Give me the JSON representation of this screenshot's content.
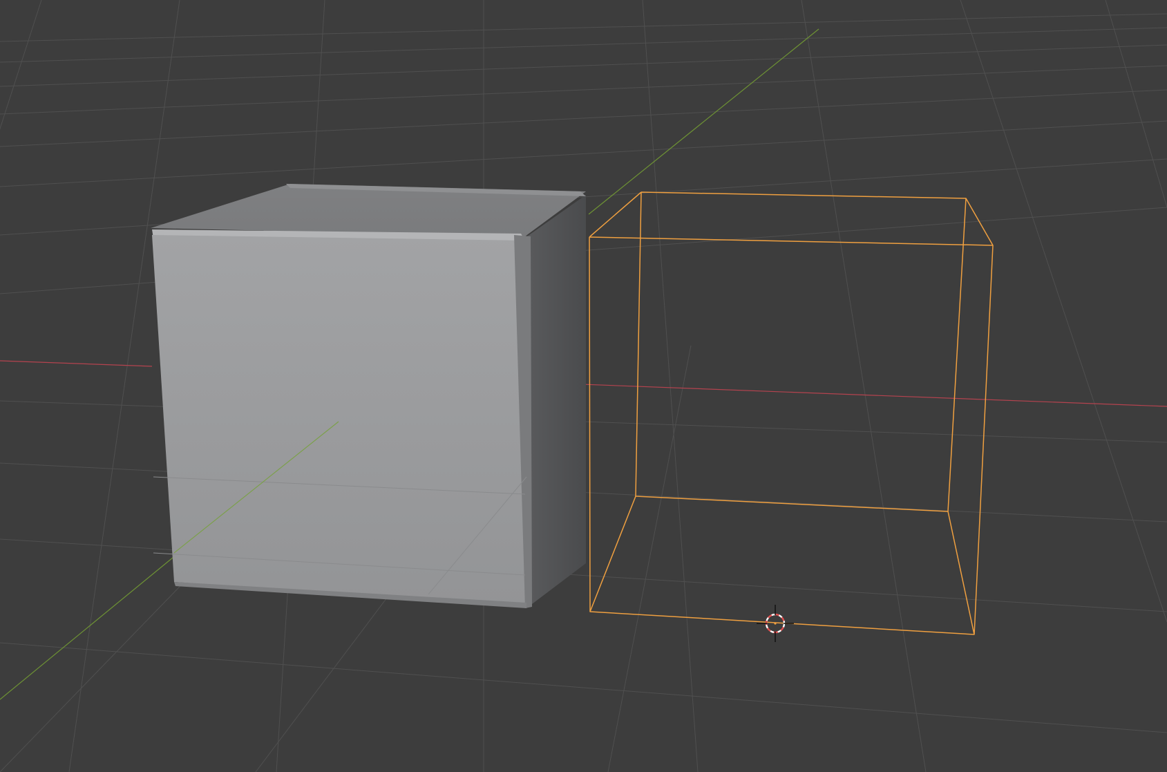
{
  "viewport": {
    "background": "#3d3d3d",
    "grid_color": "#505050",
    "x_axis_color": "#b5434f",
    "y_axis_color": "#6e9334"
  },
  "objects": [
    {
      "name": "solid-cube",
      "shading": "solid",
      "selected": false,
      "color": "#9a9b9d"
    },
    {
      "name": "wireframe-cube",
      "shading": "wireframe",
      "selected": true,
      "outline_color": "#f0a040"
    }
  ],
  "cursor": {
    "name": "3d-cursor",
    "ring_colors": [
      "#e35050",
      "#ffffff"
    ]
  }
}
